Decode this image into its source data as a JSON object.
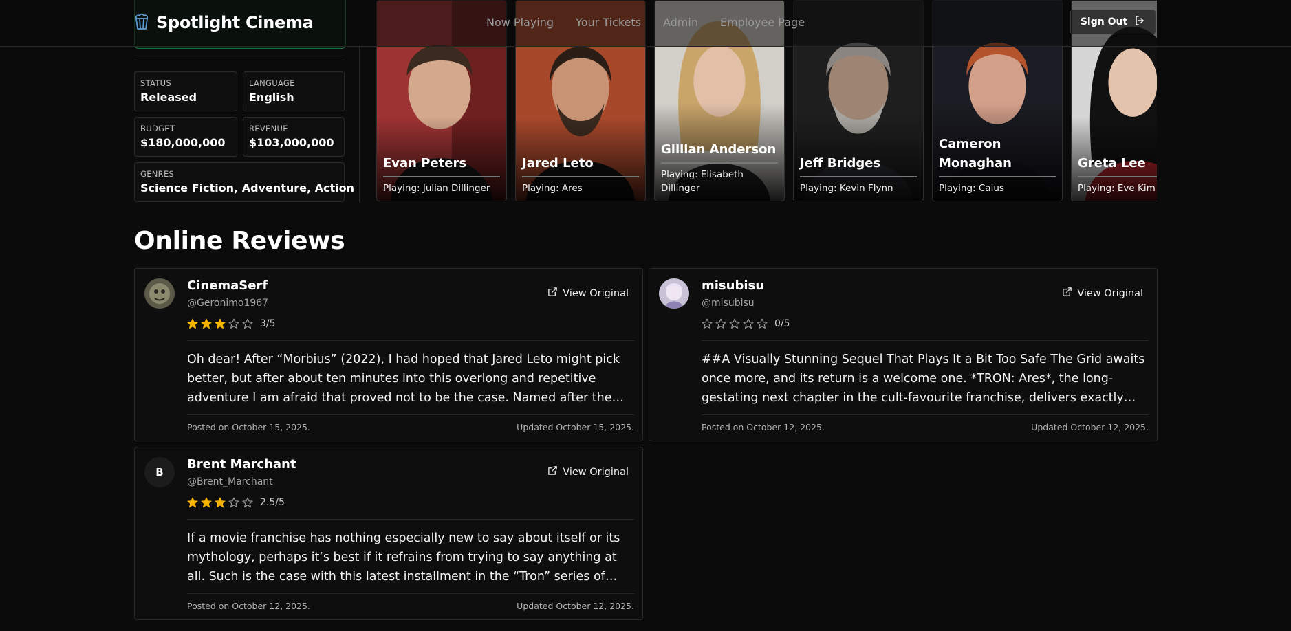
{
  "app": {
    "name": "Spotlight Cinema",
    "logo_icon": "popcorn-icon",
    "brand_color": "#5b9bd5"
  },
  "nav": [
    {
      "label": "Now Playing"
    },
    {
      "label": "Your Tickets"
    },
    {
      "label": "Admin"
    },
    {
      "label": "Employee Page"
    }
  ],
  "signout": {
    "label": "Sign Out",
    "icon": "sign-out-icon"
  },
  "details": {
    "status": {
      "label": "STATUS",
      "value": "Released"
    },
    "language": {
      "label": "LANGUAGE",
      "value": "English"
    },
    "budget": {
      "label": "BUDGET",
      "value": "$180,000,000"
    },
    "revenue": {
      "label": "REVENUE",
      "value": "$103,000,000"
    },
    "genres": {
      "label": "GENRES",
      "value": "Science Fiction, Adventure, Action"
    }
  },
  "cast": [
    {
      "name": "Evan Peters",
      "role": "Playing: Julian Dillinger",
      "bg": "#b23a3a"
    },
    {
      "name": "Jared Leto",
      "role": "Playing: Ares",
      "bg": "#b8502e"
    },
    {
      "name": "Gillian Anderson",
      "role": "Playing: Elisabeth Dillinger",
      "bg": "#d9d6d0"
    },
    {
      "name": "Jeff Bridges",
      "role": "Playing: Kevin Flynn",
      "bg": "#2a2a2a"
    },
    {
      "name": "Cameron Monaghan",
      "role": "Playing: Caius",
      "bg": "#1e2028"
    },
    {
      "name": "Greta Lee",
      "role": "Playing: Eve Kim",
      "bg": "#d8d8d8"
    }
  ],
  "reviews_section": {
    "title": "Online Reviews"
  },
  "reviews": [
    {
      "author": "CinemaSerf",
      "handle": "@Geronimo1967",
      "avatar": "statue-avatar",
      "rating_label": "3/5",
      "rating": 3,
      "link_label": "View Original",
      "content": "Oh dear! After “Morbius” (2022), I had hoped that Jared Leto might pick better, but after about ten minutes into this overlong and repetitive adventure I am afraid that proved not to be the case. Named after the…",
      "posted": "Posted on October 15, 2025.",
      "updated": "Updated October 15, 2025."
    },
    {
      "author": "misubisu",
      "handle": "@misubisu",
      "avatar": "anime-avatar",
      "rating_label": "0/5",
      "rating": 0,
      "link_label": "View Original",
      "content": "##A Visually Stunning Sequel That Plays It a Bit Too Safe The Grid awaits once more, and its return is a welcome one. *TRON: Ares*, the long-gestating next chapter in the cult-favourite franchise, delivers exactly what the trailer…",
      "posted": "Posted on October 12, 2025.",
      "updated": "Updated October 12, 2025."
    },
    {
      "author": "Brent Marchant",
      "handle": "@Brent_Marchant",
      "avatar_initial": "B",
      "rating_label": "2.5/5",
      "rating": 2.5,
      "link_label": "View Original",
      "content": "If a movie franchise has nothing especially new to say about itself or its mythology, perhaps it’s best if it refrains from trying to say anything at all. Such is the case with this latest installment in the “Tron” series of would-be…",
      "posted": "Posted on October 12, 2025.",
      "updated": "Updated October 12, 2025."
    }
  ],
  "colors": {
    "star_filled": "#f5b400",
    "star_empty": "#9a9a9a",
    "accent_green": "#1f6e3a"
  }
}
